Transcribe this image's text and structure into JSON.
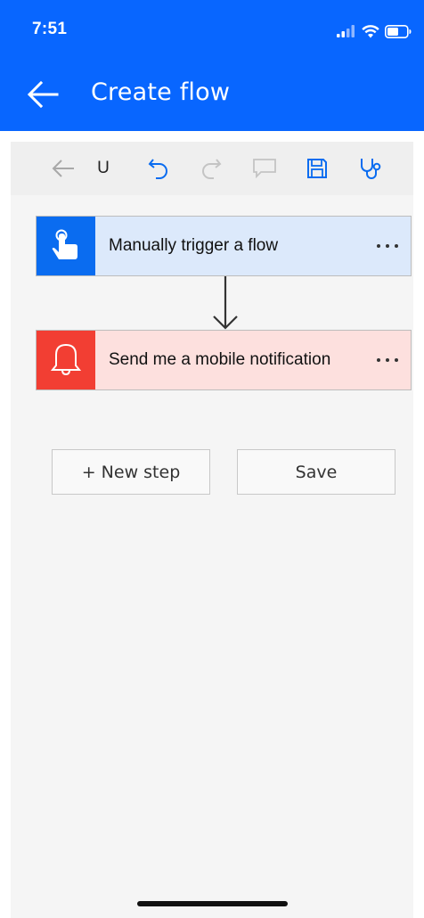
{
  "status_bar": {
    "time": "7:51",
    "icons": [
      "signal-icon",
      "wifi-icon",
      "battery-icon"
    ]
  },
  "header": {
    "title": "Create flow",
    "back_icon": "back-arrow-icon",
    "background": "#0866FF"
  },
  "toolbar": {
    "items": [
      {
        "name": "back-icon",
        "enabled": false
      },
      {
        "name": "u-label",
        "text": "U"
      },
      {
        "name": "undo-icon",
        "enabled": true
      },
      {
        "name": "redo-icon",
        "enabled": false
      },
      {
        "name": "comment-icon",
        "enabled": false
      },
      {
        "name": "save-icon",
        "enabled": true
      },
      {
        "name": "flow-checker-icon",
        "enabled": true
      }
    ],
    "u_label": "U"
  },
  "steps": [
    {
      "label": "Manually trigger a flow",
      "icon": "touch-hand-icon",
      "color": "#0a6cf0",
      "bg": "#dce9fb"
    },
    {
      "label": "Send me a mobile notification",
      "icon": "bell-icon",
      "color": "#f23e33",
      "bg": "#fde0de"
    }
  ],
  "actions": {
    "new_step": "+ New step",
    "save": "Save"
  }
}
